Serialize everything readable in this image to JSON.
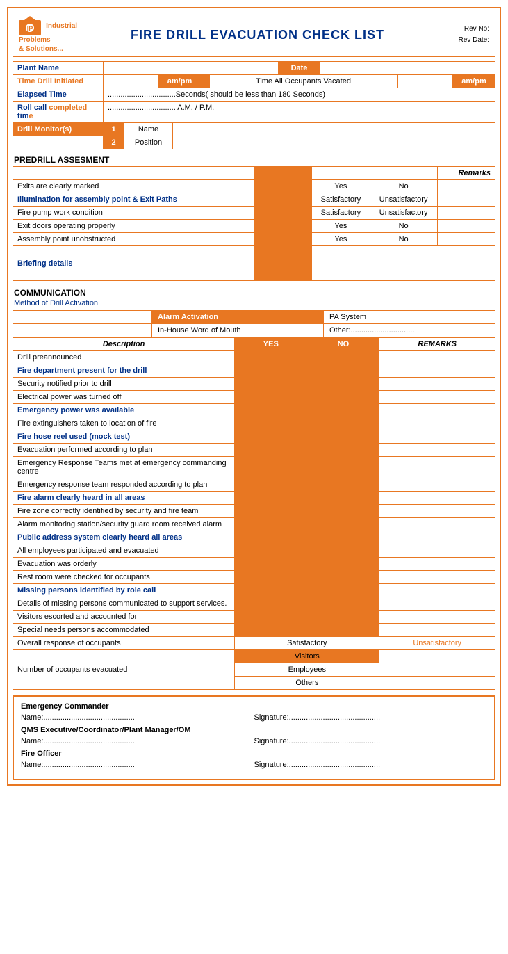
{
  "header": {
    "logo_line1": "Industrial Problems",
    "logo_line2": "& Solutions...",
    "title": "FIRE DRILL EVACUATION CHECK LIST",
    "rev_no": "Rev No:",
    "rev_date": "Rev Date:"
  },
  "info": {
    "plant_name_label": "Plant Name",
    "date_label": "Date",
    "time_drill_label": "Time Drill Initiated",
    "am_pm_1": "am/pm",
    "time_all_label": "Time All Occupants Vacated",
    "am_pm_2": "am/pm",
    "elapsed_label": "Elapsed Time",
    "elapsed_value": "................................Seconds( should be less than 180 Seconds)",
    "roll_call_label": "Roll call completed time",
    "roll_call_value": "................................ A.M. / P.M.",
    "drill_monitors_label": "Drill Monitor(s)",
    "monitor1_num": "1",
    "monitor1_name": "Name",
    "monitor2_num": "2",
    "monitor2_pos": "Position",
    "completed_label": "completed"
  },
  "predrill": {
    "title": "PREDRILL ASSESMENT",
    "remarks_header": "Remarks",
    "rows": [
      {
        "desc": "Exits are clearly marked",
        "col1": "Yes",
        "col2": "No",
        "remarks": "",
        "blue": false
      },
      {
        "desc": "Illumination for assembly point & Exit Paths",
        "col1": "Satisfactory",
        "col2": "Unsatisfactory",
        "remarks": "",
        "blue": true
      },
      {
        "desc": "Fire pump work condition",
        "col1": "Satisfactory",
        "col2": "Unsatisfactory",
        "remarks": "",
        "blue": false
      },
      {
        "desc": "Exit doors operating properly",
        "col1": "Yes",
        "col2": "No",
        "remarks": "",
        "blue": false
      },
      {
        "desc": "Assembly point unobstructed",
        "col1": "Yes",
        "col2": "No",
        "remarks": "",
        "blue": false
      },
      {
        "desc": "Briefing details",
        "col1": "",
        "col2": "",
        "remarks": "",
        "blue": false,
        "briefing": true
      }
    ]
  },
  "communication": {
    "title": "COMMUNICATION",
    "method_label": "Method of Drill Activation",
    "alarm": "Alarm Activation",
    "pa": "PA System",
    "inhouse": "In-House Word of Mouth",
    "other": "Other:..............................",
    "desc_header": "Description",
    "yes_header": "YES",
    "no_header": "NO",
    "remarks_header": "REMARKS",
    "rows": [
      {
        "desc": "Drill preannounced",
        "blue": false
      },
      {
        "desc": "Fire department present for the drill",
        "blue": true
      },
      {
        "desc": "Security notified prior to drill",
        "blue": false
      },
      {
        "desc": "Electrical power was turned off",
        "blue": false
      },
      {
        "desc": "Emergency power was available",
        "blue": true
      },
      {
        "desc": "Fire extinguishers taken to location of fire",
        "blue": false
      },
      {
        "desc": "Fire hose reel used (mock test)",
        "blue": true
      },
      {
        "desc": "Evacuation performed according to plan",
        "blue": false
      },
      {
        "desc": "Emergency Response Teams met at emergency commanding centre",
        "blue": false
      },
      {
        "desc": "Emergency response team responded according to plan",
        "blue": false
      },
      {
        "desc": "Fire alarm clearly heard in all areas",
        "blue": true
      },
      {
        "desc": "Fire zone correctly identified by security and fire team",
        "blue": false
      },
      {
        "desc": "Alarm monitoring station/security guard room received alarm",
        "blue": false
      },
      {
        "desc": "Public address system clearly heard all areas",
        "blue": true
      },
      {
        "desc": "All employees participated and evacuated",
        "blue": false
      },
      {
        "desc": "Evacuation was orderly",
        "blue": false
      },
      {
        "desc": "Rest room were checked for occupants",
        "blue": false
      },
      {
        "desc": "Missing persons identified by role call",
        "blue": true
      },
      {
        "desc": "Details of missing persons communicated to support services.",
        "blue": false
      },
      {
        "desc": "Visitors escorted and accounted for",
        "blue": false
      },
      {
        "desc": "Special needs persons accommodated",
        "blue": false
      },
      {
        "desc": "Overall response of occupants",
        "col1": "Satisfactory",
        "col2": "Unsatisfactory",
        "special": "overall"
      },
      {
        "desc": "Number of occupants evacuated",
        "sub1": "Visitors",
        "sub2": "Employees",
        "sub3": "Others",
        "special": "occupants"
      }
    ]
  },
  "signatures": {
    "ec_title": "Emergency Commander",
    "name_label": "Name:...........................................",
    "sig_label": "Signature:...........................................",
    "qms_title": "QMS Executive/Coordinator/Plant Manager/OM",
    "fo_title": "Fire Officer"
  }
}
